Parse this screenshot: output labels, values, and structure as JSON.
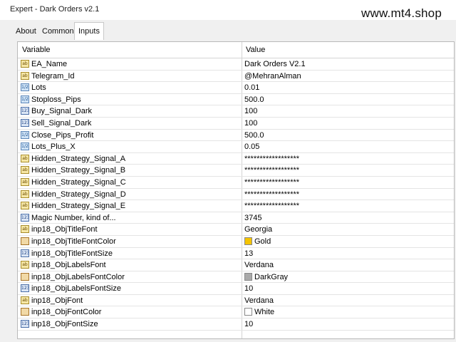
{
  "window": {
    "title": "Expert - Dark Orders v2.1",
    "watermark": "www.mt4.shop"
  },
  "tabs": [
    {
      "label": "About",
      "active": false
    },
    {
      "label": "Common",
      "active": false
    },
    {
      "label": "Inputs",
      "active": true
    }
  ],
  "grid": {
    "columns": {
      "variable": "Variable",
      "value": "Value"
    },
    "rows": [
      {
        "icon": "ab",
        "name": "EA_Name",
        "value": "Dark Orders V2.1"
      },
      {
        "icon": "ab",
        "name": "Telegram_Id",
        "value": "@MehranAlman"
      },
      {
        "icon": "num",
        "name": "Lots",
        "value": "0.01"
      },
      {
        "icon": "num",
        "name": "Stoploss_Pips",
        "value": "500.0"
      },
      {
        "icon": "int",
        "name": "Buy_Signal_Dark",
        "value": "100"
      },
      {
        "icon": "int",
        "name": "Sell_Signal_Dark",
        "value": "100"
      },
      {
        "icon": "num",
        "name": "Close_Pips_Profit",
        "value": "500.0"
      },
      {
        "icon": "num",
        "name": "Lots_Plus_X",
        "value": "0.05"
      },
      {
        "icon": "ab",
        "name": "Hidden_Strategy_Signal_A",
        "value": "******************"
      },
      {
        "icon": "ab",
        "name": "Hidden_Strategy_Signal_B",
        "value": "******************"
      },
      {
        "icon": "ab",
        "name": "Hidden_Strategy_Signal_C",
        "value": "******************"
      },
      {
        "icon": "ab",
        "name": "Hidden_Strategy_Signal_D",
        "value": "******************"
      },
      {
        "icon": "ab",
        "name": "Hidden_Strategy_Signal_E",
        "value": "******************"
      },
      {
        "icon": "int",
        "name": "Magic Number, kind of...",
        "value": "3745"
      },
      {
        "icon": "ab",
        "name": "inp18_ObjTitleFont",
        "value": "Georgia"
      },
      {
        "icon": "col",
        "name": "inp18_ObjTitleFontColor",
        "value": "Gold",
        "swatch": "#f5c400"
      },
      {
        "icon": "int",
        "name": "inp18_ObjTitleFontSize",
        "value": "13"
      },
      {
        "icon": "ab",
        "name": "inp18_ObjLabelsFont",
        "value": "Verdana"
      },
      {
        "icon": "col",
        "name": "inp18_ObjLabelsFontColor",
        "value": "DarkGray",
        "swatch": "#a9a9a9"
      },
      {
        "icon": "int",
        "name": "inp18_ObjLabelsFontSize",
        "value": "10"
      },
      {
        "icon": "ab",
        "name": "inp18_ObjFont",
        "value": "Verdana"
      },
      {
        "icon": "col",
        "name": "inp18_ObjFontColor",
        "value": "White",
        "swatch": "#ffffff"
      },
      {
        "icon": "int",
        "name": "inp18_ObjFontSize",
        "value": "10"
      }
    ]
  }
}
